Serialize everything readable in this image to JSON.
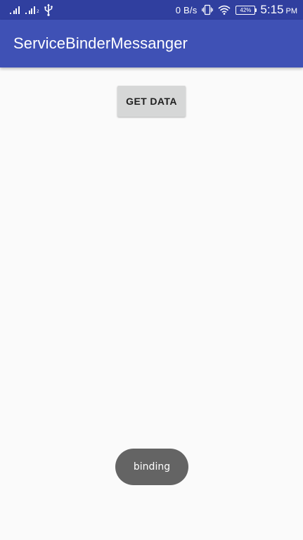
{
  "status_bar": {
    "signal1_sub": "",
    "signal2_sub": "2",
    "net_speed": "0 B/s",
    "battery": "42%",
    "time": "5:15",
    "ampm": "PM",
    "icons": [
      "signal-icon",
      "signal-icon",
      "usb-icon",
      "vibrate-icon",
      "wifi-icon",
      "battery-icon"
    ]
  },
  "app_bar": {
    "title": "ServiceBinderMessanger"
  },
  "main": {
    "get_data_label": "GET DATA"
  },
  "toast": {
    "text": "binding"
  },
  "colors": {
    "status_bar": "#303f9f",
    "app_bar": "#3f51b5",
    "background": "#fafafa",
    "button": "#d6d7d7",
    "toast": "#646464"
  }
}
